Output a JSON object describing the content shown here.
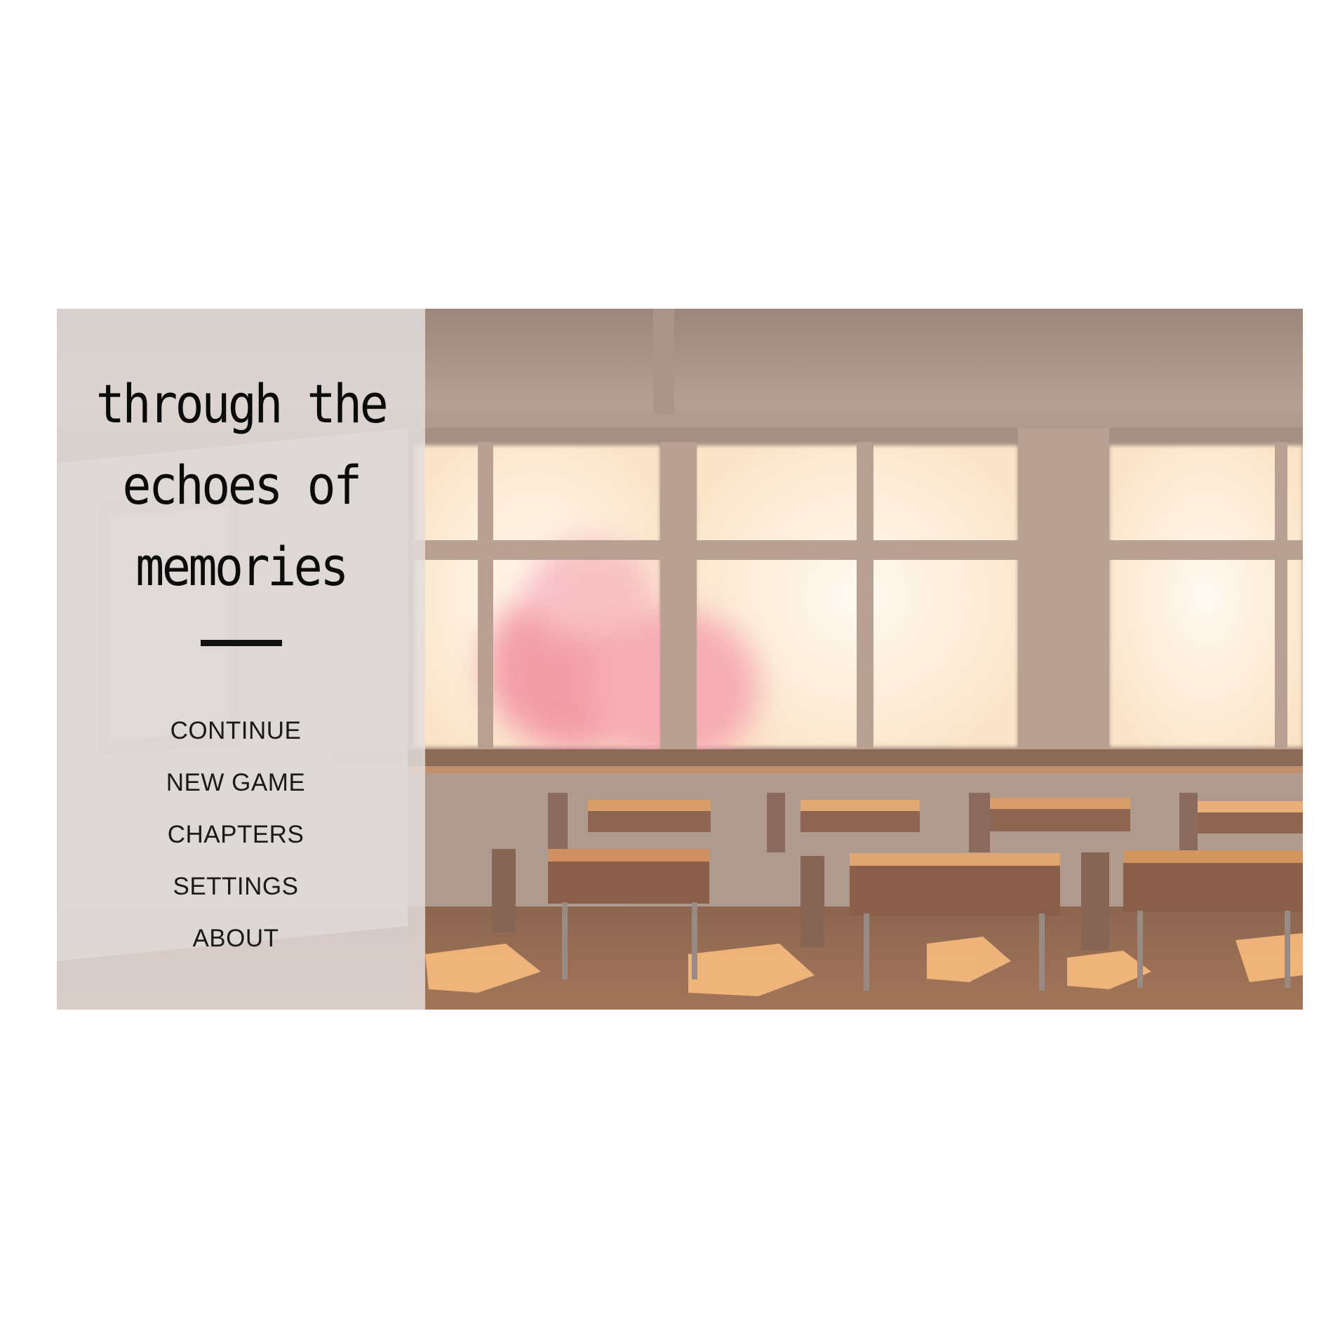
{
  "game": {
    "title_lines": [
      "through the",
      "echoes of",
      "memories"
    ]
  },
  "menu": {
    "items": [
      {
        "label": "CONTINUE"
      },
      {
        "label": "NEW GAME"
      },
      {
        "label": "CHAPTERS"
      },
      {
        "label": "SETTINGS"
      },
      {
        "label": "ABOUT"
      }
    ]
  },
  "colors": {
    "panel": "#e2dedd",
    "title_text": "#0b0b0b",
    "menu_text": "#1a1a1a",
    "wall": "#a48f85",
    "window_glow": "#fff6ea",
    "desk": "#9c6d4e",
    "sunlight": "#f4b87c",
    "cherry_blossom": "#f39aa5"
  },
  "icons": {
    "background": "classroom-sunset-illustration"
  }
}
